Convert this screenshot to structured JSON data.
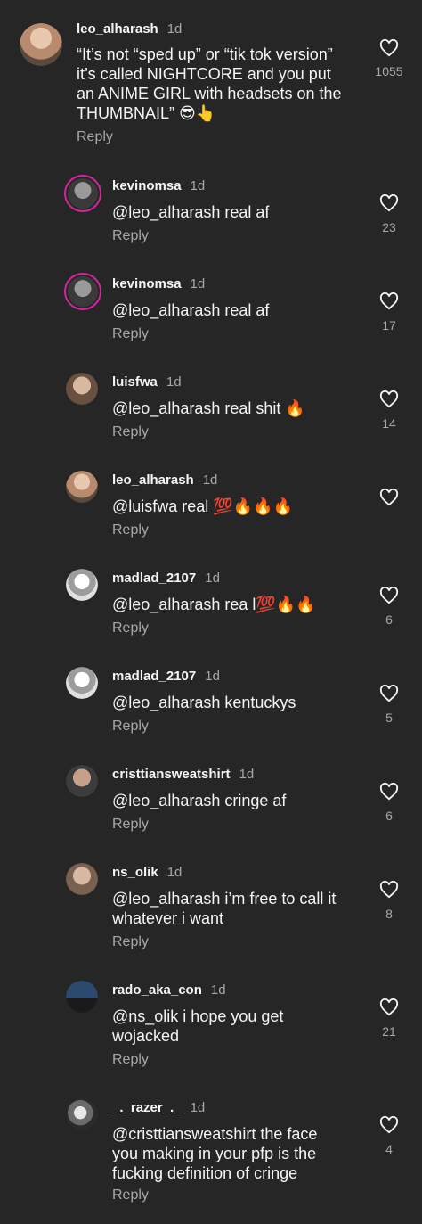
{
  "comments": [
    {
      "user": "leo_alharash",
      "time": "1d",
      "text": "“It’s not “sped up” or “tik tok version” it’s called NIGHTCORE and you put an ANIME GIRL with headsets on the THUMBNAIL” 😎👆",
      "likes": "1055",
      "reply": "Reply"
    },
    {
      "user": "kevinomsa",
      "time": "1d",
      "text": "@leo_alharash real af",
      "likes": "23",
      "reply": "Reply"
    },
    {
      "user": "kevinomsa",
      "time": "1d",
      "text": "@leo_alharash real af",
      "likes": "17",
      "reply": "Reply"
    },
    {
      "user": "luisfwa",
      "time": "1d",
      "text": "@leo_alharash real shit 🔥",
      "likes": "14",
      "reply": "Reply"
    },
    {
      "user": "leo_alharash",
      "time": "1d",
      "text": "@luisfwa real 💯🔥🔥🔥",
      "likes": "",
      "reply": "Reply"
    },
    {
      "user": "madlad_2107",
      "time": "1d",
      "text": "@leo_alharash rea l💯🔥🔥",
      "likes": "6",
      "reply": "Reply"
    },
    {
      "user": "madlad_2107",
      "time": "1d",
      "text": "@leo_alharash kentuckys",
      "likes": "5",
      "reply": "Reply"
    },
    {
      "user": "cristtiansweatshirt",
      "time": "1d",
      "text": "@leo_alharash cringe af",
      "likes": "6",
      "reply": "Reply"
    },
    {
      "user": "ns_olik",
      "time": "1d",
      "text": "@leo_alharash i’m free to call it whatever i want",
      "likes": "8",
      "reply": "Reply"
    },
    {
      "user": "rado_aka_con",
      "time": "1d",
      "text": "@ns_olik i hope you get wojacked",
      "likes": "21",
      "reply": "Reply"
    },
    {
      "user": "_._razer_._",
      "time": "1d",
      "text": "@cristtiansweatshirt the face you making in your pfp is the fucking definition of cringe",
      "likes": "4",
      "reply": "Reply"
    }
  ],
  "colors": {
    "background": "#262626",
    "text": "#f5f5f5",
    "muted": "#a8a8a8",
    "story_ring": "#d6249f"
  }
}
